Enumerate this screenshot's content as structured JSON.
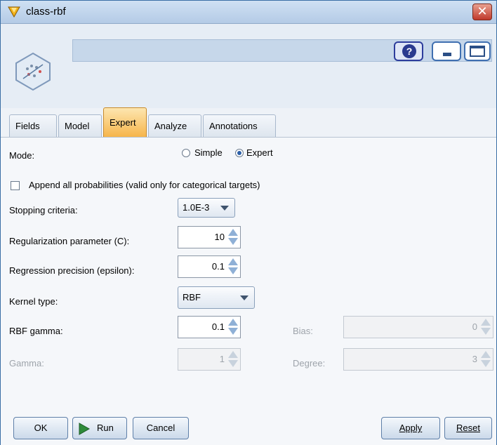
{
  "window": {
    "title": "class-rbf",
    "close_glyph": "✕"
  },
  "header": {
    "help_glyph": "?"
  },
  "tabs": [
    {
      "label": "Fields",
      "active": false
    },
    {
      "label": "Model",
      "active": false
    },
    {
      "label": "Expert",
      "active": true
    },
    {
      "label": "Analyze",
      "active": false
    },
    {
      "label": "Annotations",
      "active": false
    }
  ],
  "form": {
    "mode_label": "Mode:",
    "mode_simple": "Simple",
    "mode_expert": "Expert",
    "mode_selected": "Expert",
    "append_label": "Append all probabilities (valid only for categorical targets)",
    "append_checked": false,
    "stopping_label": "Stopping criteria:",
    "stopping_value": "1.0E-3",
    "reg_label": "Regularization parameter (C):",
    "reg_value": "10",
    "eps_label": "Regression precision (epsilon):",
    "eps_value": "0.1",
    "kernel_label": "Kernel type:",
    "kernel_value": "RBF",
    "rbf_gamma_label": "RBF gamma:",
    "rbf_gamma_value": "0.1",
    "bias_label": "Bias:",
    "bias_value": "0",
    "gamma_label": "Gamma:",
    "gamma_value": "1",
    "degree_label": "Degree:",
    "degree_value": "3"
  },
  "buttons": {
    "ok": "OK",
    "run": "Run",
    "cancel": "Cancel",
    "apply": "Apply",
    "reset": "Reset"
  },
  "colors": {
    "accent": "#f6b54b",
    "titlebar": "#b4cbe6",
    "run_icon": "#2e8b3a"
  }
}
